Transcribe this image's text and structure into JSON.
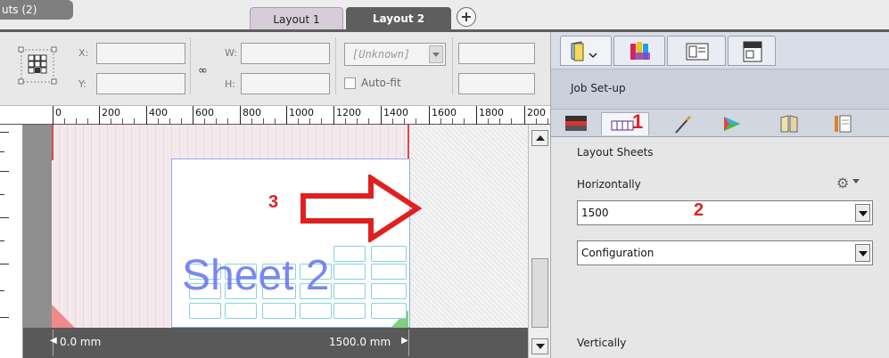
{
  "tabs": {
    "previous": "uts (2)",
    "layout1": "Layout 1",
    "layout2": "Layout 2",
    "add_symbol": "+"
  },
  "toolbar": {
    "x_label": "X:",
    "y_label": "Y:",
    "w_label": "W:",
    "h_label": "H:",
    "x_value": "",
    "y_value": "",
    "w_value": "",
    "h_value": "",
    "unit_select": "[Unknown]",
    "autofit_label": "Auto-fit",
    "extra_value_1": "",
    "extra_value_2": ""
  },
  "ruler": {
    "labels": [
      "0",
      "200",
      "400",
      "600",
      "800",
      "1000",
      "1200",
      "1400",
      "1600",
      "1800",
      "200"
    ]
  },
  "canvas": {
    "sheet_label": "Sheet 2",
    "left_dim": "0.0 mm",
    "right_dim": "1500.0 mm"
  },
  "annotations": {
    "one": "1",
    "two": "2",
    "three": "3"
  },
  "panel": {
    "section_title": "Job Set-up",
    "subsection": "Layout Sheets",
    "horizontal_label": "Horizontally",
    "horizontal_value": "1500",
    "mode_value": "Configuration",
    "vertical_label": "Vertically"
  },
  "colors": {
    "accent_red": "#e02020",
    "sheet_text": "#6d7bf0",
    "active_tab": "#5e5e5e"
  }
}
